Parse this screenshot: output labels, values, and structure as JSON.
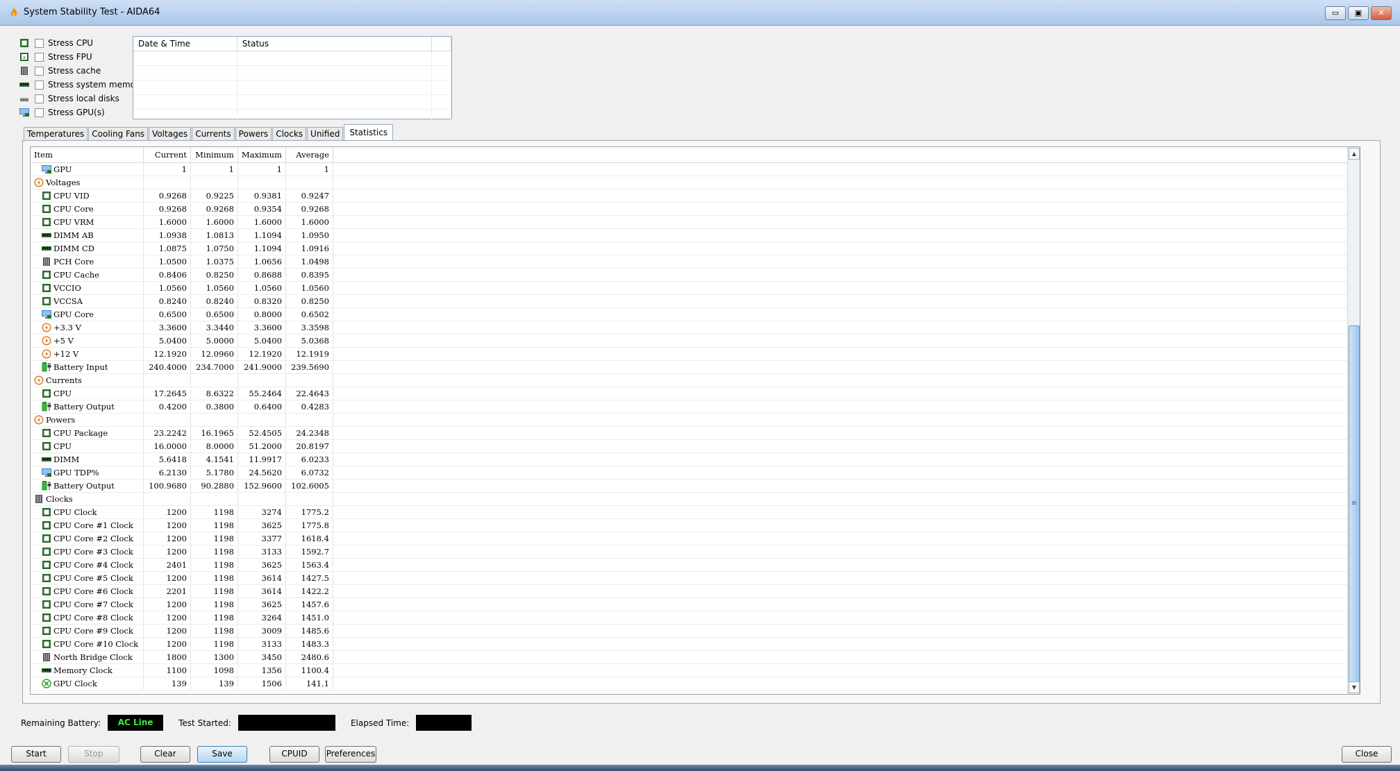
{
  "window": {
    "title": "System Stability Test - AIDA64",
    "minimize": "▭",
    "maximize": "▣",
    "close": "✕"
  },
  "stress": [
    {
      "label": "Stress CPU",
      "icon": "cpu-chip-icon"
    },
    {
      "label": "Stress FPU",
      "icon": "fpu-chip-icon"
    },
    {
      "label": "Stress cache",
      "icon": "cache-icon"
    },
    {
      "label": "Stress system memory",
      "icon": "memory-module-icon"
    },
    {
      "label": "Stress local disks",
      "icon": "disk-drive-icon"
    },
    {
      "label": "Stress GPU(s)",
      "icon": "monitor-gpu-icon"
    }
  ],
  "log": {
    "col_date": "Date & Time",
    "col_status": "Status"
  },
  "tabs": [
    {
      "label": "Temperatures",
      "active": false
    },
    {
      "label": "Cooling Fans",
      "active": false
    },
    {
      "label": "Voltages",
      "active": false
    },
    {
      "label": "Currents",
      "active": false
    },
    {
      "label": "Powers",
      "active": false
    },
    {
      "label": "Clocks",
      "active": false
    },
    {
      "label": "Unified",
      "active": false
    },
    {
      "label": "Statistics",
      "active": true
    }
  ],
  "stats": {
    "headers": {
      "item": "Item",
      "current": "Current",
      "minimum": "Minimum",
      "maximum": "Maximum",
      "average": "Average"
    },
    "rows": [
      {
        "label": "GPU",
        "icon": "monitor-gpu-icon",
        "group": false,
        "cur": "1",
        "min": "1",
        "max": "1",
        "avg": "1"
      },
      {
        "label": "Voltages",
        "icon": "voltage-group-icon",
        "group": true,
        "cur": "",
        "min": "",
        "max": "",
        "avg": ""
      },
      {
        "label": "CPU VID",
        "icon": "cpu-chip-icon",
        "group": false,
        "cur": "0.9268",
        "min": "0.9225",
        "max": "0.9381",
        "avg": "0.9247"
      },
      {
        "label": "CPU Core",
        "icon": "cpu-chip-icon",
        "group": false,
        "cur": "0.9268",
        "min": "0.9268",
        "max": "0.9354",
        "avg": "0.9268"
      },
      {
        "label": "CPU VRM",
        "icon": "cpu-chip-icon",
        "group": false,
        "cur": "1.6000",
        "min": "1.6000",
        "max": "1.6000",
        "avg": "1.6000"
      },
      {
        "label": "DIMM AB",
        "icon": "memory-module-icon",
        "group": false,
        "cur": "1.0938",
        "min": "1.0813",
        "max": "1.1094",
        "avg": "1.0950"
      },
      {
        "label": "DIMM CD",
        "icon": "memory-module-icon",
        "group": false,
        "cur": "1.0875",
        "min": "1.0750",
        "max": "1.1094",
        "avg": "1.0916"
      },
      {
        "label": "PCH Core",
        "icon": "chipset-icon",
        "group": false,
        "cur": "1.0500",
        "min": "1.0375",
        "max": "1.0656",
        "avg": "1.0498"
      },
      {
        "label": "CPU Cache",
        "icon": "cpu-chip-icon",
        "group": false,
        "cur": "0.8406",
        "min": "0.8250",
        "max": "0.8688",
        "avg": "0.8395"
      },
      {
        "label": "VCCIO",
        "icon": "cpu-chip-icon",
        "group": false,
        "cur": "1.0560",
        "min": "1.0560",
        "max": "1.0560",
        "avg": "1.0560"
      },
      {
        "label": "VCCSA",
        "icon": "cpu-chip-icon",
        "group": false,
        "cur": "0.8240",
        "min": "0.8240",
        "max": "0.8320",
        "avg": "0.8250"
      },
      {
        "label": "GPU Core",
        "icon": "monitor-gpu-icon",
        "group": false,
        "cur": "0.6500",
        "min": "0.6500",
        "max": "0.8000",
        "avg": "0.6502"
      },
      {
        "label": "+3.3 V",
        "icon": "voltage-icon",
        "group": false,
        "cur": "3.3600",
        "min": "3.3440",
        "max": "3.3600",
        "avg": "3.3598"
      },
      {
        "label": "+5 V",
        "icon": "voltage-icon",
        "group": false,
        "cur": "5.0400",
        "min": "5.0000",
        "max": "5.0400",
        "avg": "5.0368"
      },
      {
        "label": "+12 V",
        "icon": "voltage-icon",
        "group": false,
        "cur": "12.1920",
        "min": "12.0960",
        "max": "12.1920",
        "avg": "12.1919"
      },
      {
        "label": "Battery Input",
        "icon": "battery-icon",
        "group": false,
        "cur": "240.4000",
        "min": "234.7000",
        "max": "241.9000",
        "avg": "239.5690"
      },
      {
        "label": "Currents",
        "icon": "voltage-group-icon",
        "group": true,
        "cur": "",
        "min": "",
        "max": "",
        "avg": ""
      },
      {
        "label": "CPU",
        "icon": "cpu-chip-icon",
        "group": false,
        "cur": "17.2645",
        "min": "8.6322",
        "max": "55.2464",
        "avg": "22.4643"
      },
      {
        "label": "Battery Output",
        "icon": "battery-icon",
        "group": false,
        "cur": "0.4200",
        "min": "0.3800",
        "max": "0.6400",
        "avg": "0.4283"
      },
      {
        "label": "Powers",
        "icon": "voltage-group-icon",
        "group": true,
        "cur": "",
        "min": "",
        "max": "",
        "avg": ""
      },
      {
        "label": "CPU Package",
        "icon": "cpu-chip-icon",
        "group": false,
        "cur": "23.2242",
        "min": "16.1965",
        "max": "52.4505",
        "avg": "24.2348"
      },
      {
        "label": "CPU",
        "icon": "cpu-chip-icon",
        "group": false,
        "cur": "16.0000",
        "min": "8.0000",
        "max": "51.2000",
        "avg": "20.8197"
      },
      {
        "label": "DIMM",
        "icon": "memory-module-icon",
        "group": false,
        "cur": "5.6418",
        "min": "4.1541",
        "max": "11.9917",
        "avg": "6.0233"
      },
      {
        "label": "GPU TDP%",
        "icon": "monitor-gpu-icon",
        "group": false,
        "cur": "6.2130",
        "min": "5.1780",
        "max": "24.5620",
        "avg": "6.0732"
      },
      {
        "label": "Battery Output",
        "icon": "battery-icon",
        "group": false,
        "cur": "100.9680",
        "min": "90.2880",
        "max": "152.9600",
        "avg": "102.6005"
      },
      {
        "label": "Clocks",
        "icon": "chipset-icon",
        "group": true,
        "cur": "",
        "min": "",
        "max": "",
        "avg": ""
      },
      {
        "label": "CPU Clock",
        "icon": "cpu-chip-icon",
        "group": false,
        "cur": "1200",
        "min": "1198",
        "max": "3274",
        "avg": "1775.2"
      },
      {
        "label": "CPU Core #1 Clock",
        "icon": "cpu-chip-icon",
        "group": false,
        "cur": "1200",
        "min": "1198",
        "max": "3625",
        "avg": "1775.8"
      },
      {
        "label": "CPU Core #2 Clock",
        "icon": "cpu-chip-icon",
        "group": false,
        "cur": "1200",
        "min": "1198",
        "max": "3377",
        "avg": "1618.4"
      },
      {
        "label": "CPU Core #3 Clock",
        "icon": "cpu-chip-icon",
        "group": false,
        "cur": "1200",
        "min": "1198",
        "max": "3133",
        "avg": "1592.7"
      },
      {
        "label": "CPU Core #4 Clock",
        "icon": "cpu-chip-icon",
        "group": false,
        "cur": "2401",
        "min": "1198",
        "max": "3625",
        "avg": "1563.4"
      },
      {
        "label": "CPU Core #5 Clock",
        "icon": "cpu-chip-icon",
        "group": false,
        "cur": "1200",
        "min": "1198",
        "max": "3614",
        "avg": "1427.5"
      },
      {
        "label": "CPU Core #6 Clock",
        "icon": "cpu-chip-icon",
        "group": false,
        "cur": "2201",
        "min": "1198",
        "max": "3614",
        "avg": "1422.2"
      },
      {
        "label": "CPU Core #7 Clock",
        "icon": "cpu-chip-icon",
        "group": false,
        "cur": "1200",
        "min": "1198",
        "max": "3625",
        "avg": "1457.6"
      },
      {
        "label": "CPU Core #8 Clock",
        "icon": "cpu-chip-icon",
        "group": false,
        "cur": "1200",
        "min": "1198",
        "max": "3264",
        "avg": "1451.0"
      },
      {
        "label": "CPU Core #9 Clock",
        "icon": "cpu-chip-icon",
        "group": false,
        "cur": "1200",
        "min": "1198",
        "max": "3009",
        "avg": "1485.6"
      },
      {
        "label": "CPU Core #10 Clock",
        "icon": "cpu-chip-icon",
        "group": false,
        "cur": "1200",
        "min": "1198",
        "max": "3133",
        "avg": "1483.3"
      },
      {
        "label": "North Bridge Clock",
        "icon": "chipset-icon",
        "group": false,
        "cur": "1800",
        "min": "1300",
        "max": "3450",
        "avg": "2480.6"
      },
      {
        "label": "Memory Clock",
        "icon": "memory-module-icon",
        "group": false,
        "cur": "1100",
        "min": "1098",
        "max": "1356",
        "avg": "1100.4"
      },
      {
        "label": "GPU Clock",
        "icon": "xbox-gpu-icon",
        "group": false,
        "cur": "139",
        "min": "139",
        "max": "1506",
        "avg": "141.1"
      }
    ]
  },
  "scrollbar": {
    "up": "▲",
    "down": "▼",
    "grip": "≡"
  },
  "status": {
    "battery_label": "Remaining Battery:",
    "battery_value": "AC Line",
    "started_label": "Test Started:",
    "elapsed_label": "Elapsed Time:"
  },
  "buttons": {
    "start": "Start",
    "stop": "Stop",
    "clear": "Clear",
    "save": "Save",
    "cpuid": "CPUID",
    "preferences": "Preferences",
    "close": "Close"
  }
}
